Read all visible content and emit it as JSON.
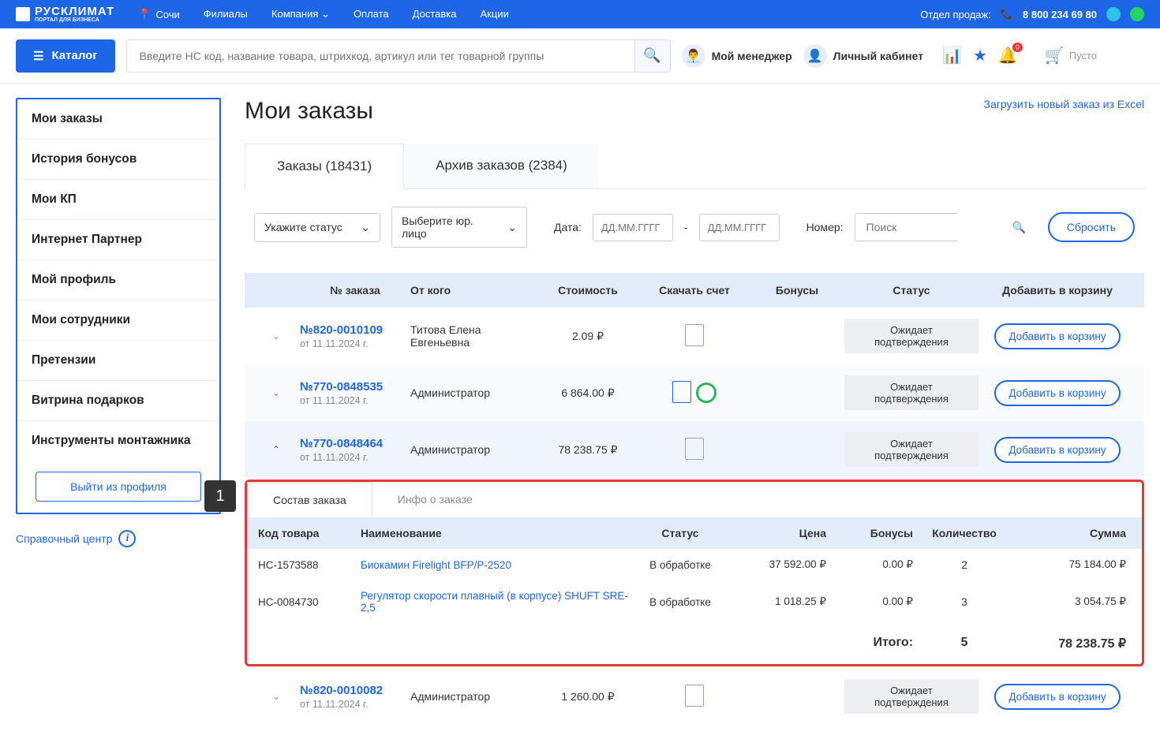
{
  "top": {
    "brand_main": "РУСКЛИМАТ",
    "brand_sub": "ПОРТАЛ ДЛЯ БИЗНЕСА",
    "city": "Сочи",
    "nav": [
      "Филиалы",
      "Компания",
      "Оплата",
      "Доставка",
      "Акции"
    ],
    "sales_label": "Отдел продаж:",
    "phone": "8 800 234 69 80"
  },
  "header": {
    "catalog": "Каталог",
    "search_placeholder": "Введите НС код, название товара, штрихкод, артикул или тег товарной группы",
    "manager": "Мой менеджер",
    "account": "Личный кабинет",
    "notif_badge": "0",
    "cart": "Пусто"
  },
  "sidebar": {
    "items": [
      "Мои заказы",
      "История бонусов",
      "Мои КП",
      "Интернет Партнер",
      "Мой профиль",
      "Мои сотрудники",
      "Претензии",
      "Витрина подарков",
      "Инструменты монтажника"
    ],
    "logout": "Выйти из профиля",
    "help": "Справочный центр"
  },
  "page": {
    "title": "Мои заказы",
    "excel_link": "Загрузить новый заказ из Excel"
  },
  "tabs": {
    "orders": "Заказы (18431)",
    "archive": "Архив заказов (2384)"
  },
  "filters": {
    "status": "Укажите статус",
    "legal": "Выберите юр. лицо",
    "date_label": "Дата:",
    "date_ph": "ДД.ММ.ГГГГ",
    "sep": "-",
    "num_label": "Номер:",
    "num_ph": "Поиск",
    "reset": "Сбросить"
  },
  "cols": {
    "num": "№ заказа",
    "from": "От кого",
    "cost": "Стоимость",
    "invoice": "Скачать счет",
    "bonus": "Бонусы",
    "status": "Статус",
    "add": "Добавить в корзину"
  },
  "orders": [
    {
      "num": "№820-0010109",
      "date": "от 11.11.2024 г.",
      "from": "Титова Елена Евгеньевна",
      "cost": "2.09 ₽",
      "status": "Ожидает подтверждения",
      "add": "Добавить в корзину",
      "inv": "plain"
    },
    {
      "num": "№770-0848535",
      "date": "от 11.11.2024 г.",
      "from": "Администратор",
      "cost": "6 864.00 ₽",
      "status": "Ожидает подтверждения",
      "add": "Добавить в корзину",
      "inv": "sber"
    },
    {
      "num": "№770-0848464",
      "date": "от 11.11.2024 г.",
      "from": "Администратор",
      "cost": "78 238.75 ₽",
      "status": "Ожидает подтверждения",
      "add": "Добавить в корзину",
      "inv": "plain"
    },
    {
      "num": "№820-0010082",
      "date": "от 11.11.2024 г.",
      "from": "Администратор",
      "cost": "1 260.00 ₽",
      "status": "Ожидает подтверждения",
      "add": "Добавить в корзину",
      "inv": "plain"
    }
  ],
  "annotation": "1",
  "detail_tabs": {
    "content": "Состав заказа",
    "info": "Инфо о заказе"
  },
  "detail_cols": {
    "code": "Код товара",
    "name": "Наименование",
    "status": "Статус",
    "price": "Цена",
    "bonus": "Бонусы",
    "qty": "Количество",
    "sum": "Сумма"
  },
  "detail_rows": [
    {
      "code": "НС-1573588",
      "name": "Биокамин Firelight BFP/P-2520",
      "status": "В обработке",
      "price": "37 592.00 ₽",
      "bonus": "0.00 ₽",
      "qty": "2",
      "sum": "75 184.00 ₽"
    },
    {
      "code": "НС-0084730",
      "name": "Регулятор скорости плавный (в корпусе) SHUFT SRE-2,5",
      "status": "В обработке",
      "price": "1 018.25 ₽",
      "bonus": "0.00 ₽",
      "qty": "3",
      "sum": "3 054.75 ₽"
    }
  ],
  "total": {
    "label": "Итого:",
    "qty": "5",
    "sum": "78 238.75 ₽"
  }
}
